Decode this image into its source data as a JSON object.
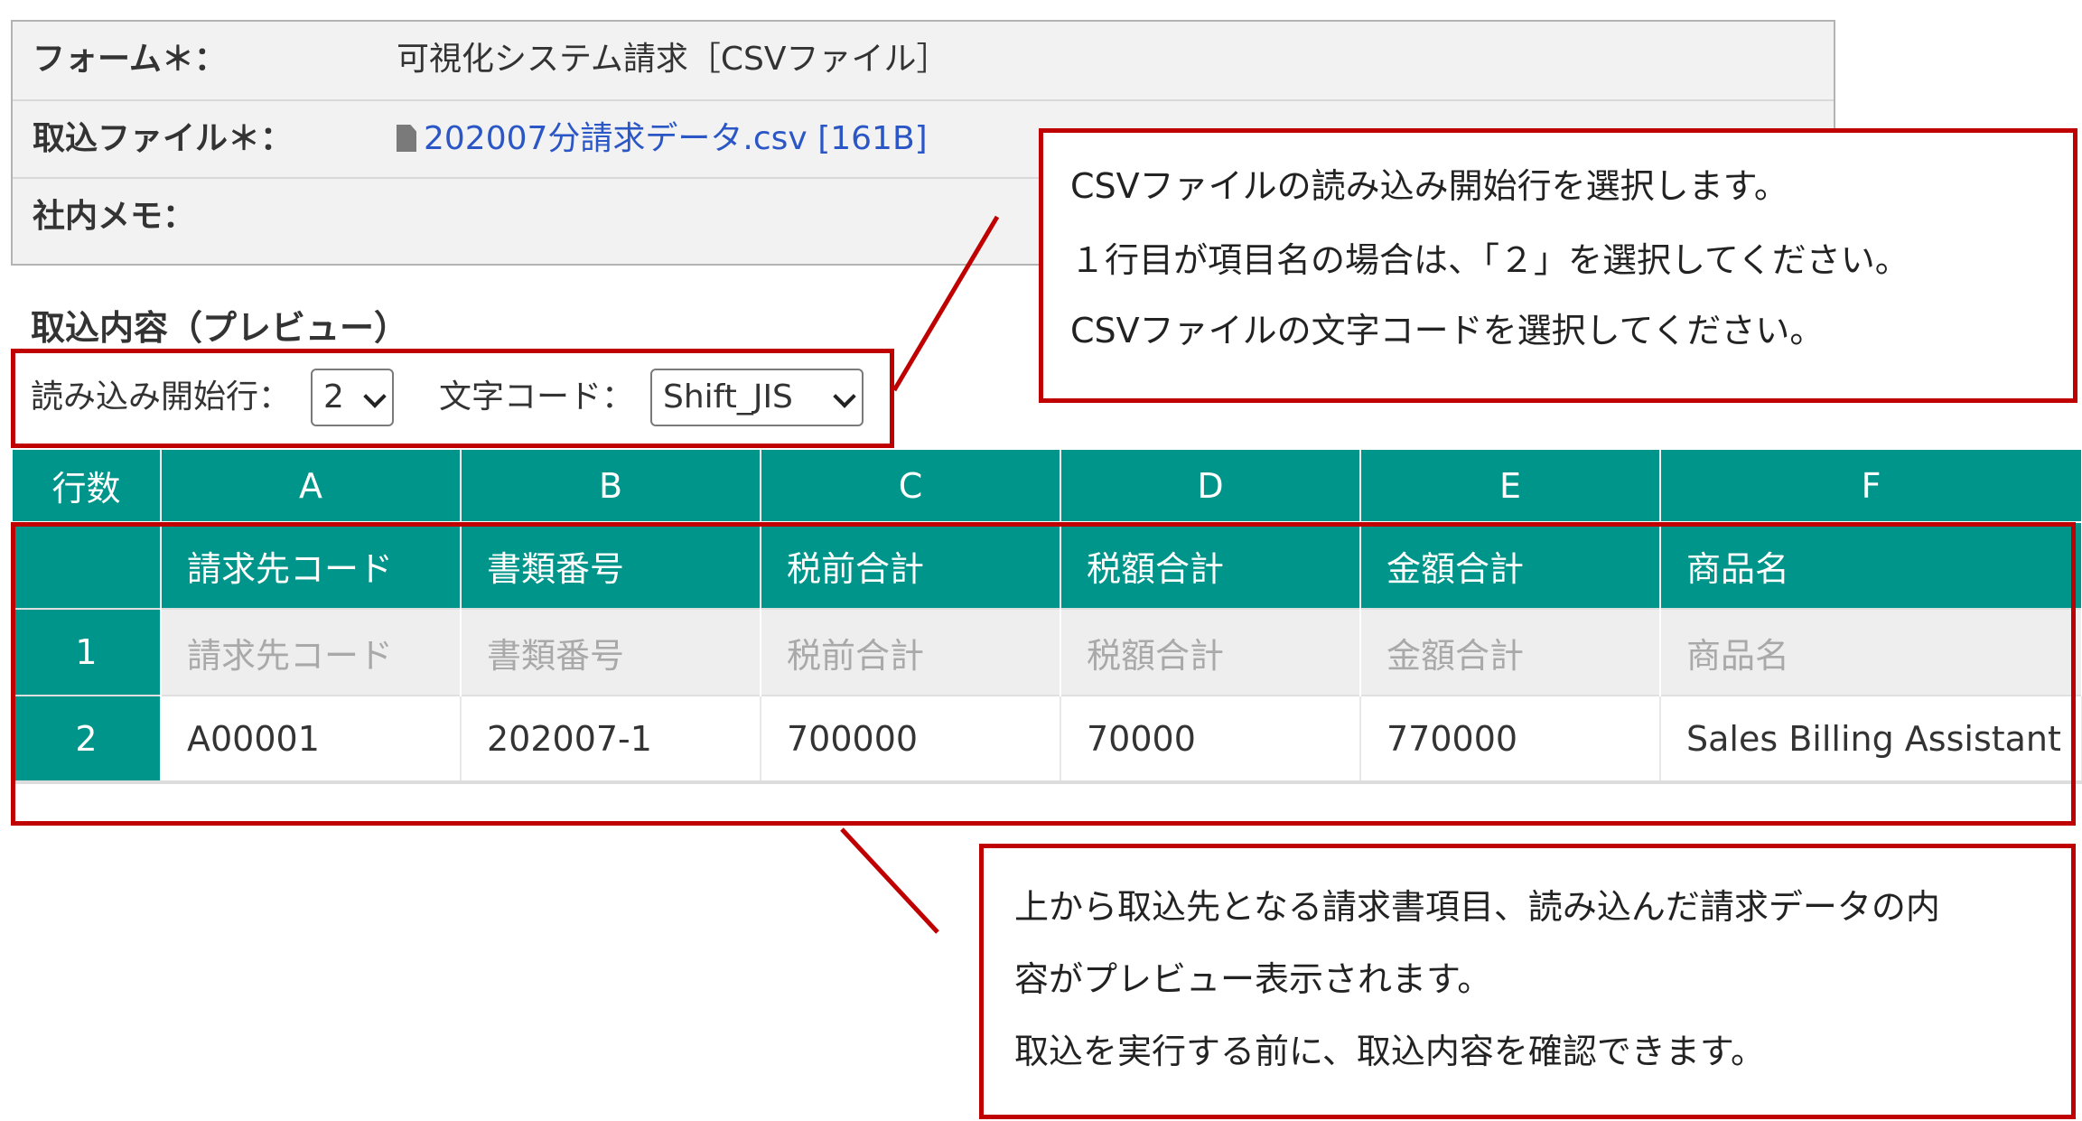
{
  "form": {
    "form_label": "フォーム＊：",
    "form_value": "可視化システム請求［CSVファイル］",
    "file_label": "取込ファイル＊：",
    "file_name": "202007分請求データ.csv",
    "file_size": "[161B]",
    "file_icon": "file-icon",
    "memo_label": "社内メモ："
  },
  "preview": {
    "title": "取込内容（プレビュー）",
    "start_row_label": "読み込み開始行：",
    "start_row_value": "2",
    "encoding_label": "文字コード：",
    "encoding_value": "Shift_JIS"
  },
  "table": {
    "row_count_header": "行数",
    "columns": [
      "A",
      "B",
      "C",
      "D",
      "E",
      "F"
    ],
    "target_fields": [
      "請求先コード",
      "書類番号",
      "税前合計",
      "税額合計",
      "金額合計",
      "商品名"
    ],
    "rows": [
      {
        "num": "1",
        "cells": [
          "請求先コード",
          "書類番号",
          "税前合計",
          "税額合計",
          "金額合計",
          "商品名"
        ]
      },
      {
        "num": "2",
        "cells": [
          "A00001",
          "202007-1",
          "700000",
          "70000",
          "770000",
          "Sales Billing Assistant"
        ]
      }
    ]
  },
  "callouts": {
    "top": [
      "CSVファイルの読み込み開始行を選択します。",
      "１行目が項目名の場合は、「２」を選択してください。",
      "CSVファイルの文字コードを選択してください。"
    ],
    "bottom": [
      "上から取込先となる請求書項目、読み込んだ請求データの内",
      "容がプレビュー表示されます。",
      "取込を実行する前に、取込内容を確認できます。"
    ]
  },
  "colors": {
    "teal": "#00958a",
    "annotation_red": "#c00000",
    "link_blue": "#2a56c6"
  }
}
